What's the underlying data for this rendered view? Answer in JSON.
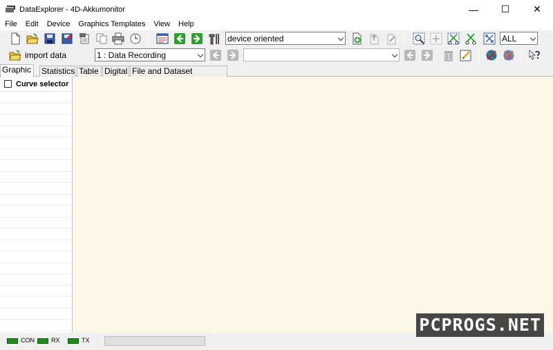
{
  "window": {
    "title": "DataExplorer  -  4D-Akkumonitor",
    "minimize": "—",
    "maximize": "☐",
    "close": "✕"
  },
  "menu": [
    "File",
    "Edit",
    "Device",
    "Graphics Templates",
    "View",
    "Help"
  ],
  "toolbar": {
    "view_mode": "device oriented",
    "filter": "ALL",
    "import_label": "import data",
    "record_set": "1 : Data Recording",
    "record_comment": ""
  },
  "tabs": [
    "Graphic",
    "Statistics",
    "Table",
    "Digital",
    "File and Dataset Comment"
  ],
  "active_tab": "Graphic",
  "curve_selector": {
    "label": "Curve selector",
    "checked": false
  },
  "status": {
    "leds": [
      "CON",
      "RX",
      "TX"
    ],
    "led_color": "#1f8a1f"
  },
  "colors": {
    "graph_background": "#fbf8e8",
    "accent_green": "#2e9e2e"
  },
  "watermark": "PCPROGS.NET"
}
